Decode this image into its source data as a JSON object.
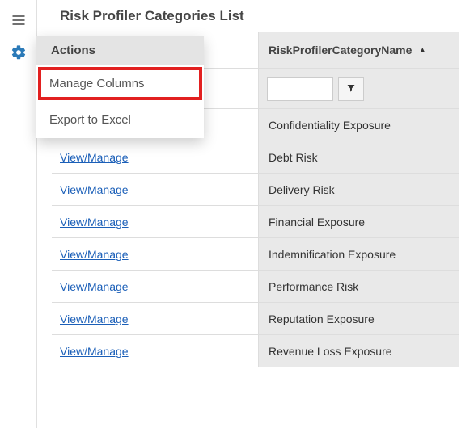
{
  "header": {
    "title": "Risk Profiler Categories List"
  },
  "actions_menu": {
    "label": "Actions",
    "items": [
      {
        "label": "Manage Columns",
        "highlight": true
      },
      {
        "label": "Export to Excel",
        "highlight": false
      }
    ]
  },
  "table": {
    "header": {
      "name_col_label": "RiskProfilerCategoryName"
    },
    "filter": {
      "name_value": ""
    },
    "action_link_label": "View/Manage",
    "rows": [
      {
        "name": "Confidentiality Exposure"
      },
      {
        "name": "Debt Risk"
      },
      {
        "name": "Delivery Risk"
      },
      {
        "name": "Financial Exposure"
      },
      {
        "name": "Indemnification Exposure"
      },
      {
        "name": "Performance Risk"
      },
      {
        "name": "Reputation Exposure"
      },
      {
        "name": "Revenue Loss Exposure"
      }
    ]
  }
}
